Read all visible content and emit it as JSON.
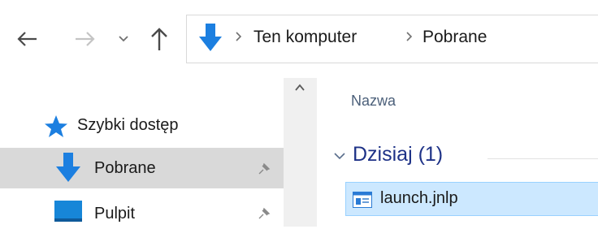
{
  "address_bar": {
    "icons": {
      "back": "arrow-left-icon",
      "forward": "arrow-right-icon",
      "recent": "chevron-down-icon",
      "up": "arrow-up-icon",
      "location": "downloads-arrow-icon",
      "separator": "chevron-right-icon"
    },
    "breadcrumbs": [
      "Ten komputer",
      "Pobrane"
    ]
  },
  "nav_pane": {
    "items": [
      {
        "label": "Szybki dostęp",
        "icon": "star-icon"
      },
      {
        "label": "Pobrane",
        "icon": "downloads-arrow-icon",
        "pinned": true,
        "selected": true
      },
      {
        "label": "Pulpit",
        "icon": "desktop-folder-icon",
        "pinned": true
      }
    ]
  },
  "content": {
    "column_header": "Nazwa",
    "group": {
      "label": "Dzisiaj (1)",
      "expanded": true
    },
    "files": [
      {
        "name": "launch.jnlp",
        "icon": "jnlp-file-icon",
        "selected": true
      }
    ]
  },
  "colors": {
    "accent_blue": "#1c7fe0",
    "selection": "#cce8ff",
    "nav_selected": "#d9d9d9",
    "group_header": "#1e3287"
  }
}
